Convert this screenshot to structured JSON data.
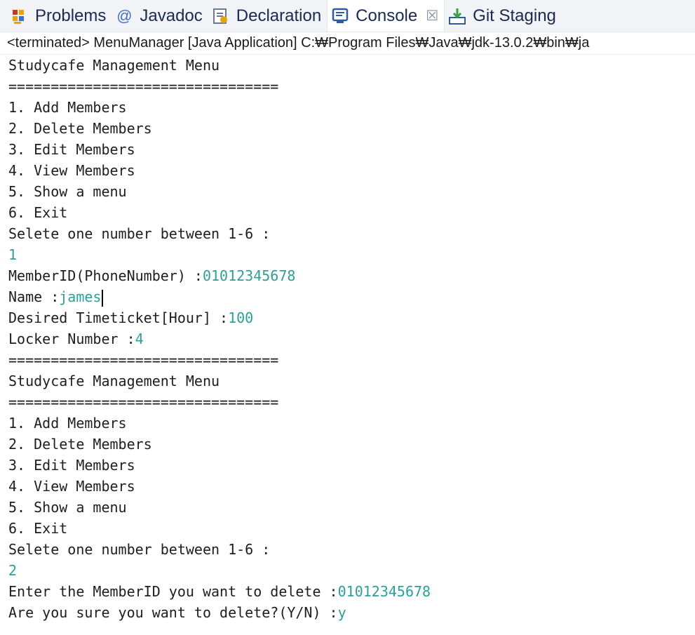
{
  "tabs": [
    {
      "label": "Problems",
      "icon": "problems-icon"
    },
    {
      "label": "Javadoc",
      "icon": "javadoc-icon"
    },
    {
      "label": "Declaration",
      "icon": "declaration-icon"
    },
    {
      "label": "Console",
      "icon": "console-icon",
      "active": true,
      "close": "☒"
    },
    {
      "label": "Git Staging",
      "icon": "git-staging-icon"
    }
  ],
  "status": "<terminated> MenuManager [Java Application] C:₩Program Files₩Java₩jdk-13.0.2₩bin₩ja",
  "console": {
    "title1": "Studycafe Management Menu",
    "sep1": "================================",
    "menu1": [
      "1. Add Members",
      "2. Delete Members",
      "3. Edit Members",
      "4. View Members",
      "5. Show a menu",
      "6. Exit"
    ],
    "prompt1": "Selete one number between 1-6 :",
    "input1": "1",
    "member_id_label": "MemberID(PhoneNumber) :",
    "member_id_value": "01012345678",
    "name_label": "Name :",
    "name_value": "james",
    "ticket_label": "Desired Timeticket[Hour] :",
    "ticket_value": "100",
    "locker_label": "Locker Number :",
    "locker_value": "4",
    "sep2": "================================",
    "title2": "Studycafe Management Menu",
    "sep3": "================================",
    "menu2": [
      "1. Add Members",
      "2. Delete Members",
      "3. Edit Members",
      "4. View Members",
      "5. Show a menu",
      "6. Exit"
    ],
    "prompt2": "Selete one number between 1-6 :",
    "input2": "2",
    "delete_label": "Enter the MemberID you want to delete :",
    "delete_value": "01012345678",
    "confirm_label": "Are you sure you want to delete?(Y/N) :",
    "confirm_value": "y"
  },
  "colors": {
    "input": "#2aa198",
    "text": "#1e1e1e"
  }
}
